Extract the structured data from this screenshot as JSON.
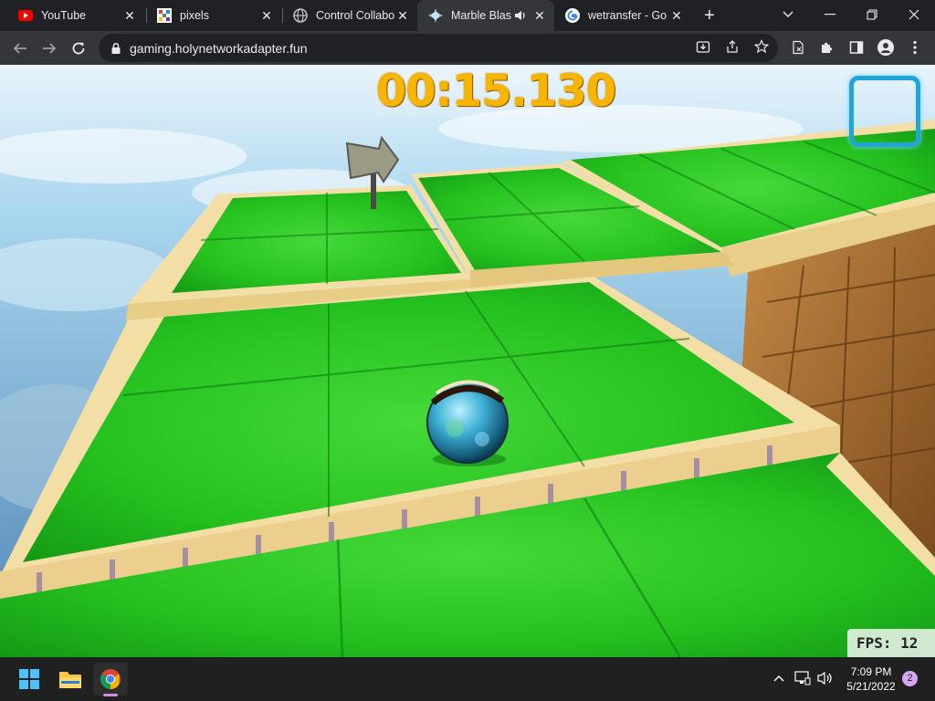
{
  "browser": {
    "tabs": [
      {
        "title": "YouTube",
        "favicon": "youtube-icon",
        "active": false
      },
      {
        "title": "pixels",
        "favicon": "pixels-icon",
        "active": false
      },
      {
        "title": "Control Collabo",
        "favicon": "globe-icon",
        "active": false
      },
      {
        "title": "Marble Blas",
        "favicon": "marble-blast-icon",
        "active": true,
        "audio": "speaker-icon"
      },
      {
        "title": "wetransfer - Go",
        "favicon": "google-icon",
        "active": false
      }
    ],
    "new_tab_icon": "plus-icon",
    "address": "gaming.holynetworkadapter.fun",
    "colors": {
      "frame": "#202124",
      "toolbar": "#35363a",
      "omnibox": "#202124",
      "text": "#e8eaed"
    }
  },
  "game": {
    "timer": "00:15.130",
    "fps_label": "FPS: 12",
    "gem_indicator": "empty-gem-frame",
    "colors": {
      "timer": "#f7b500",
      "tile_green": "#21c41f",
      "edge_cream": "#f3dea6",
      "frame_blue": "#1fa5d8"
    }
  },
  "taskbar": {
    "apps": [
      "windows-start-icon",
      "file-explorer-icon",
      "chrome-icon"
    ],
    "tray_icons": [
      "chevron-up-icon",
      "network-icon",
      "volume-icon"
    ],
    "time": "7:09 PM",
    "date": "5/21/2022",
    "notification_count": "2"
  }
}
